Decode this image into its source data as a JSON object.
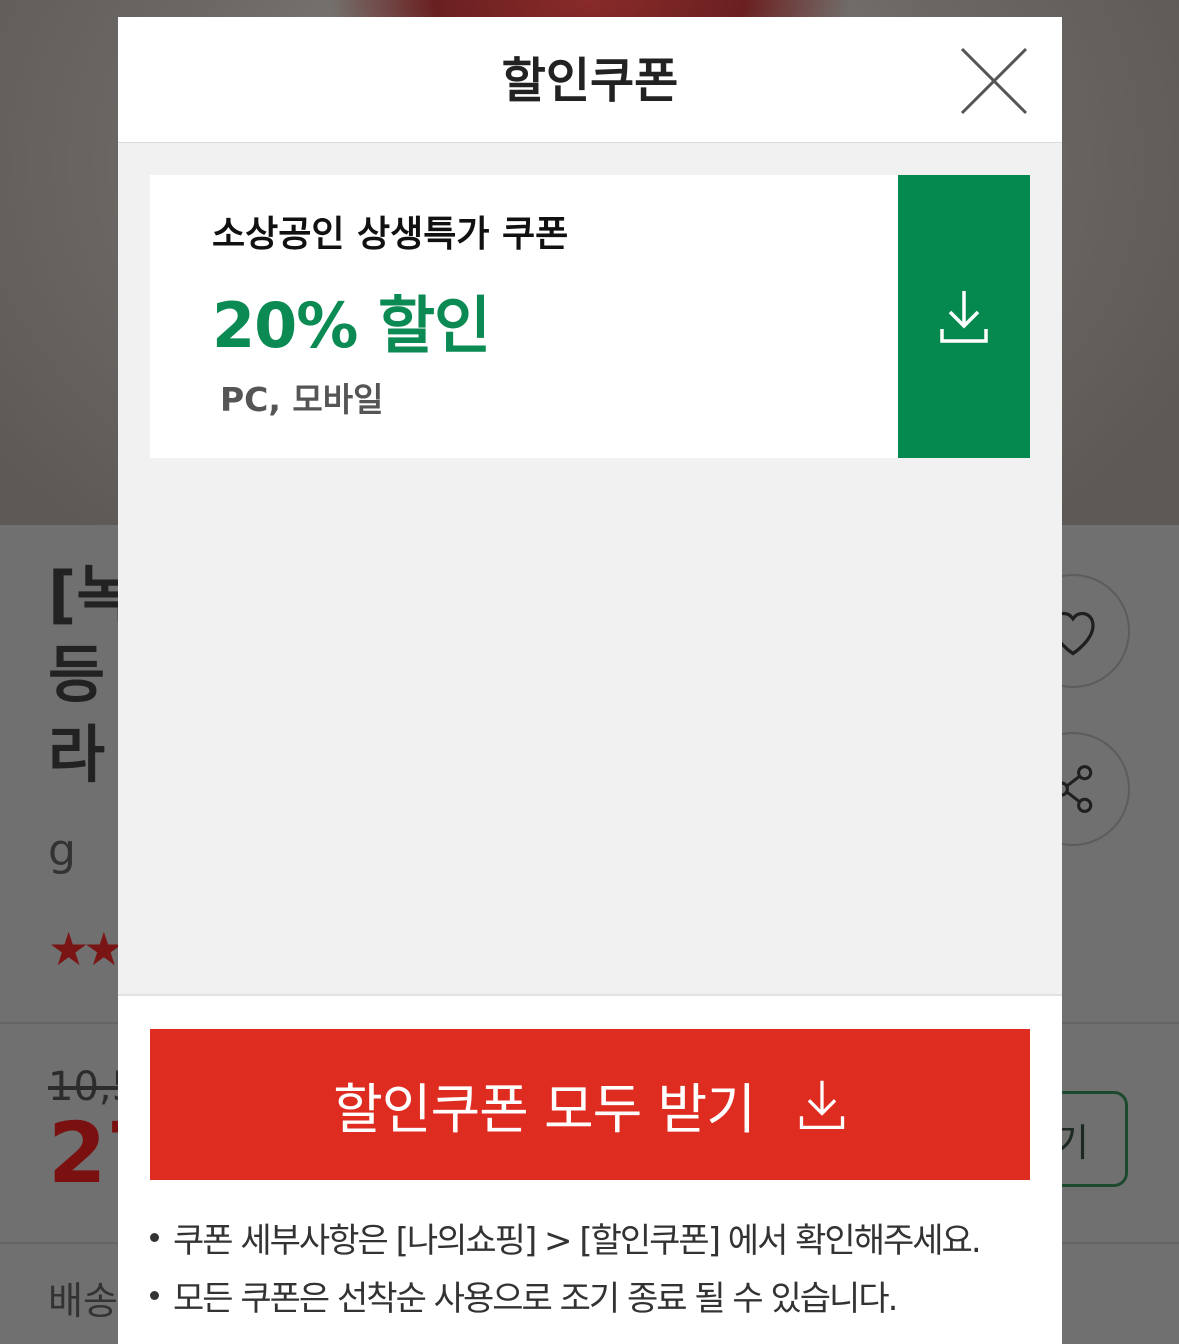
{
  "background": {
    "title_lines": "[녹\n등\n라",
    "unit": "g",
    "stars": "★★",
    "old_price": "10,5",
    "price": "27",
    "delivery_label": "배송",
    "buy_button_label": "기"
  },
  "modal": {
    "title": "할인쿠폰",
    "close_icon": "close-icon",
    "coupons": [
      {
        "name": "소상공인 상생특가 쿠폰",
        "discount": "20% 할인",
        "platform": "PC, 모바일",
        "download_icon": "download-icon"
      }
    ],
    "download_all_label": "할인쿠폰 모두 받기",
    "notes": [
      "쿠폰 세부사항은 [나의쇼핑] > [할인쿠폰] 에서 확인해주세요.",
      "모든 쿠폰은 선착순 사용으로 조기 종료 될 수 있습니다."
    ]
  },
  "colors": {
    "accent_green": "#06894f",
    "discount_green": "#0b8a54",
    "cta_red": "#df2c20",
    "overlay_gray": "#707070"
  }
}
